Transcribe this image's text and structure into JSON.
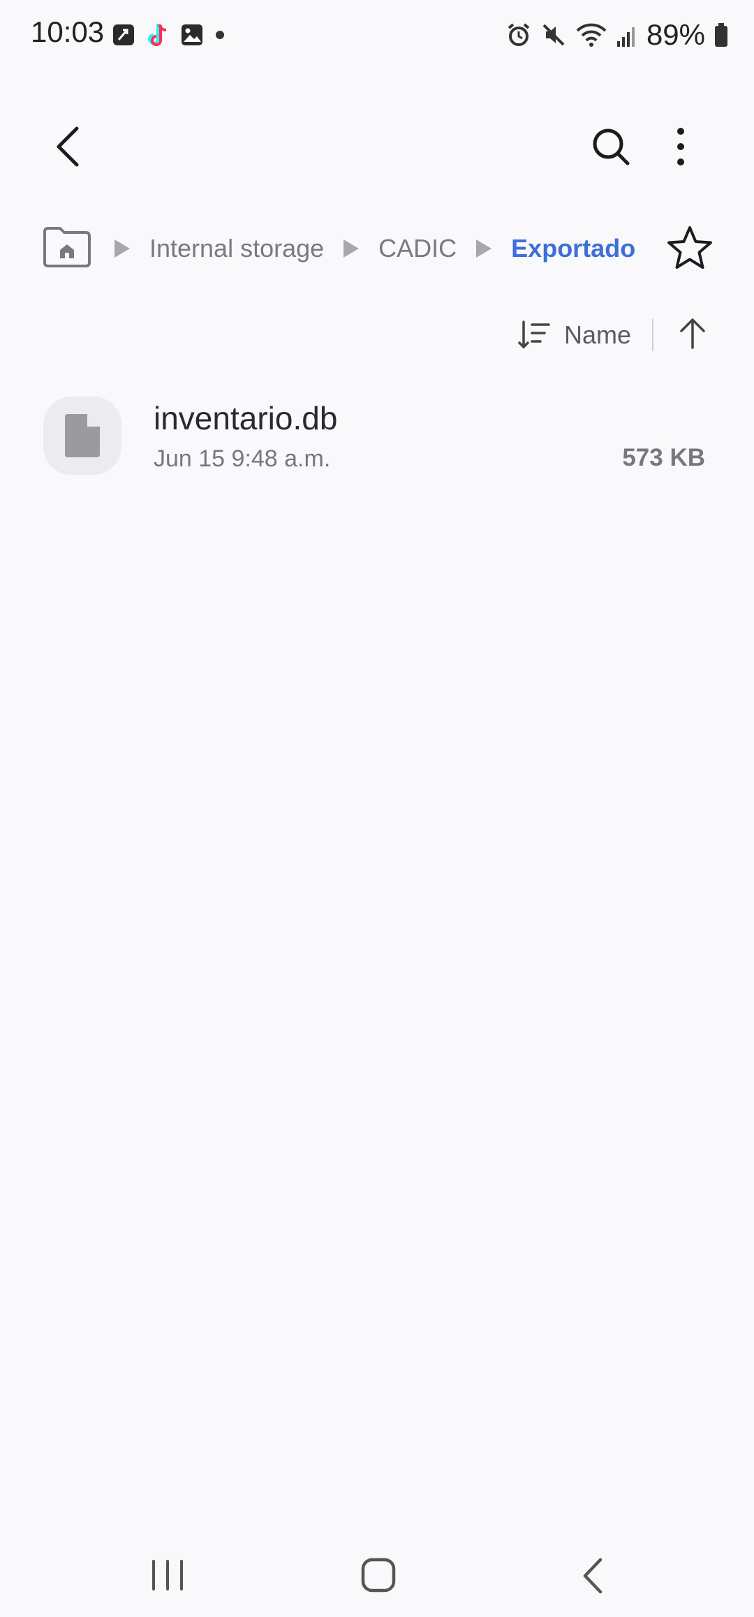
{
  "status_bar": {
    "time": "10:03",
    "battery": "89%",
    "left_icons": [
      "phone-call-icon",
      "tiktok-icon",
      "gallery-icon",
      "notification-dot-icon"
    ],
    "right_icons": [
      "alarm-icon",
      "mute-icon",
      "wifi-icon",
      "signal-icon",
      "battery-icon"
    ]
  },
  "toolbar": {
    "icons": [
      "back-icon",
      "search-icon",
      "more-options-icon"
    ]
  },
  "breadcrumb": {
    "items": [
      {
        "label": "Internal storage"
      },
      {
        "label": "CADIC"
      },
      {
        "label": "Exportado"
      }
    ],
    "active_color": "#3e6ed8"
  },
  "sort": {
    "label": "Name",
    "direction": "ascending"
  },
  "files": [
    {
      "name": "inventario.db",
      "date": "Jun 15 9:48 a.m.",
      "size": "573 KB",
      "icon": "document-icon"
    }
  ],
  "nav_bar": {
    "icons": [
      "recent-apps-icon",
      "home-icon",
      "back-icon"
    ]
  }
}
